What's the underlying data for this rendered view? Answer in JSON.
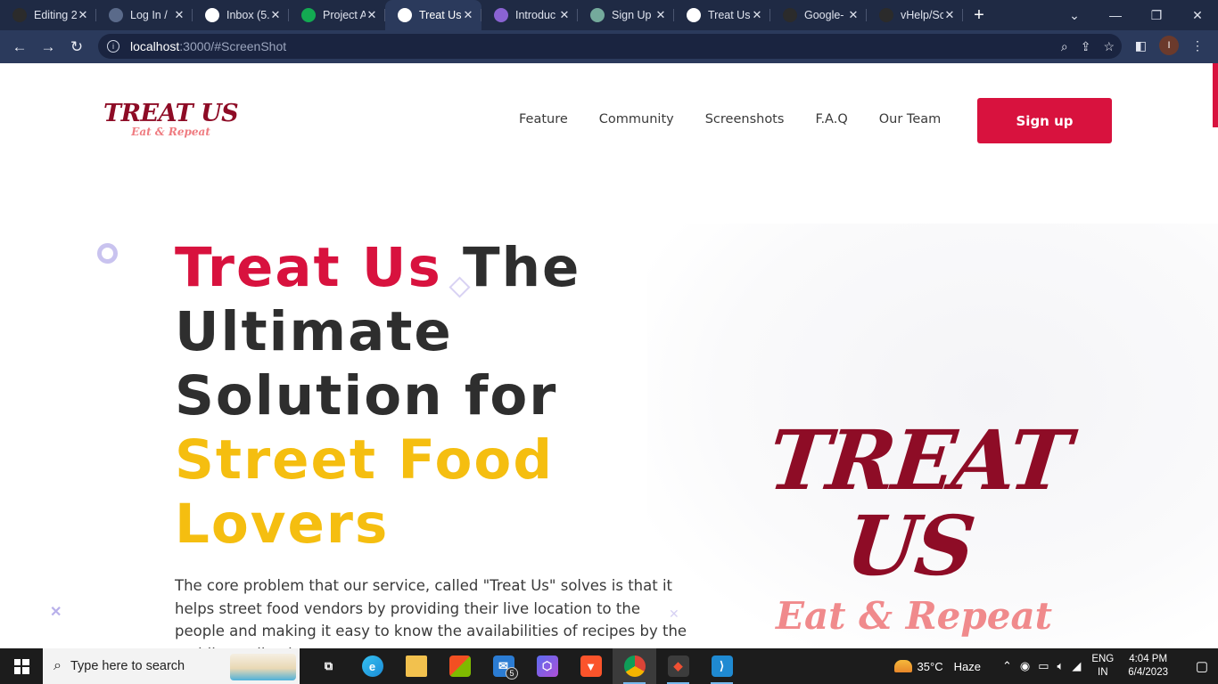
{
  "browser": {
    "tabs": [
      {
        "title": "Editing 2",
        "favicon": "github-icon",
        "color": "#2b2b2b",
        "active": false
      },
      {
        "title": "Log In / ",
        "favicon": "globe-icon",
        "color": "#5a6a8a",
        "active": false
      },
      {
        "title": "Inbox (5.",
        "favicon": "gmail-icon",
        "color": "#ffffff",
        "active": false
      },
      {
        "title": "Project A",
        "favicon": "leaf-icon",
        "color": "#13aa52",
        "active": false
      },
      {
        "title": "Treat Us",
        "favicon": "treatus-icon",
        "color": "#ffffff",
        "active": true
      },
      {
        "title": "Introduc",
        "favicon": "spiral-icon",
        "color": "#8a63d2",
        "active": false
      },
      {
        "title": "Sign Up",
        "favicon": "openai-icon",
        "color": "#74aa9c",
        "active": false
      },
      {
        "title": "Treat Us",
        "favicon": "treatus-icon",
        "color": "#ffffff",
        "active": false
      },
      {
        "title": "Google-",
        "favicon": "github-icon",
        "color": "#2b2b2b",
        "active": false
      },
      {
        "title": "vHelp/Sc",
        "favicon": "github-icon",
        "color": "#2b2b2b",
        "active": false
      }
    ],
    "url_host": "localhost",
    "url_path": ":3000/#ScreenShot"
  },
  "site": {
    "logo_main": "TREAT US",
    "logo_sub": "Eat & Repeat",
    "nav": [
      "Feature",
      "Community",
      "Screenshots",
      "F.A.Q",
      "Our Team"
    ],
    "signup_label": "Sign up"
  },
  "hero": {
    "title_part1": "Treat Us",
    "title_part2": " The Ultimate Solution for ",
    "title_part3": "Street Food Lovers",
    "description": "The core problem that our service, called \"Treat Us\" solves is that it helps street food vendors by providing their live location to the people and making it easy to know the availabilities of recipes by the mobile application.",
    "image_main": "TREAT US",
    "image_sub": "Eat & Repeat"
  },
  "taskbar": {
    "search_placeholder": "Type here to search",
    "mail_badge": "5",
    "weather_temp": "35°C",
    "weather_text": "Haze",
    "lang_line1": "ENG",
    "lang_line2": "IN",
    "time": "4:04 PM",
    "date": "6/4/2023"
  },
  "colors": {
    "brand_red": "#d8123e",
    "logo_maroon": "#8e0c26",
    "accent_yellow": "#f5be10",
    "logo_pink": "#ef7b80"
  }
}
